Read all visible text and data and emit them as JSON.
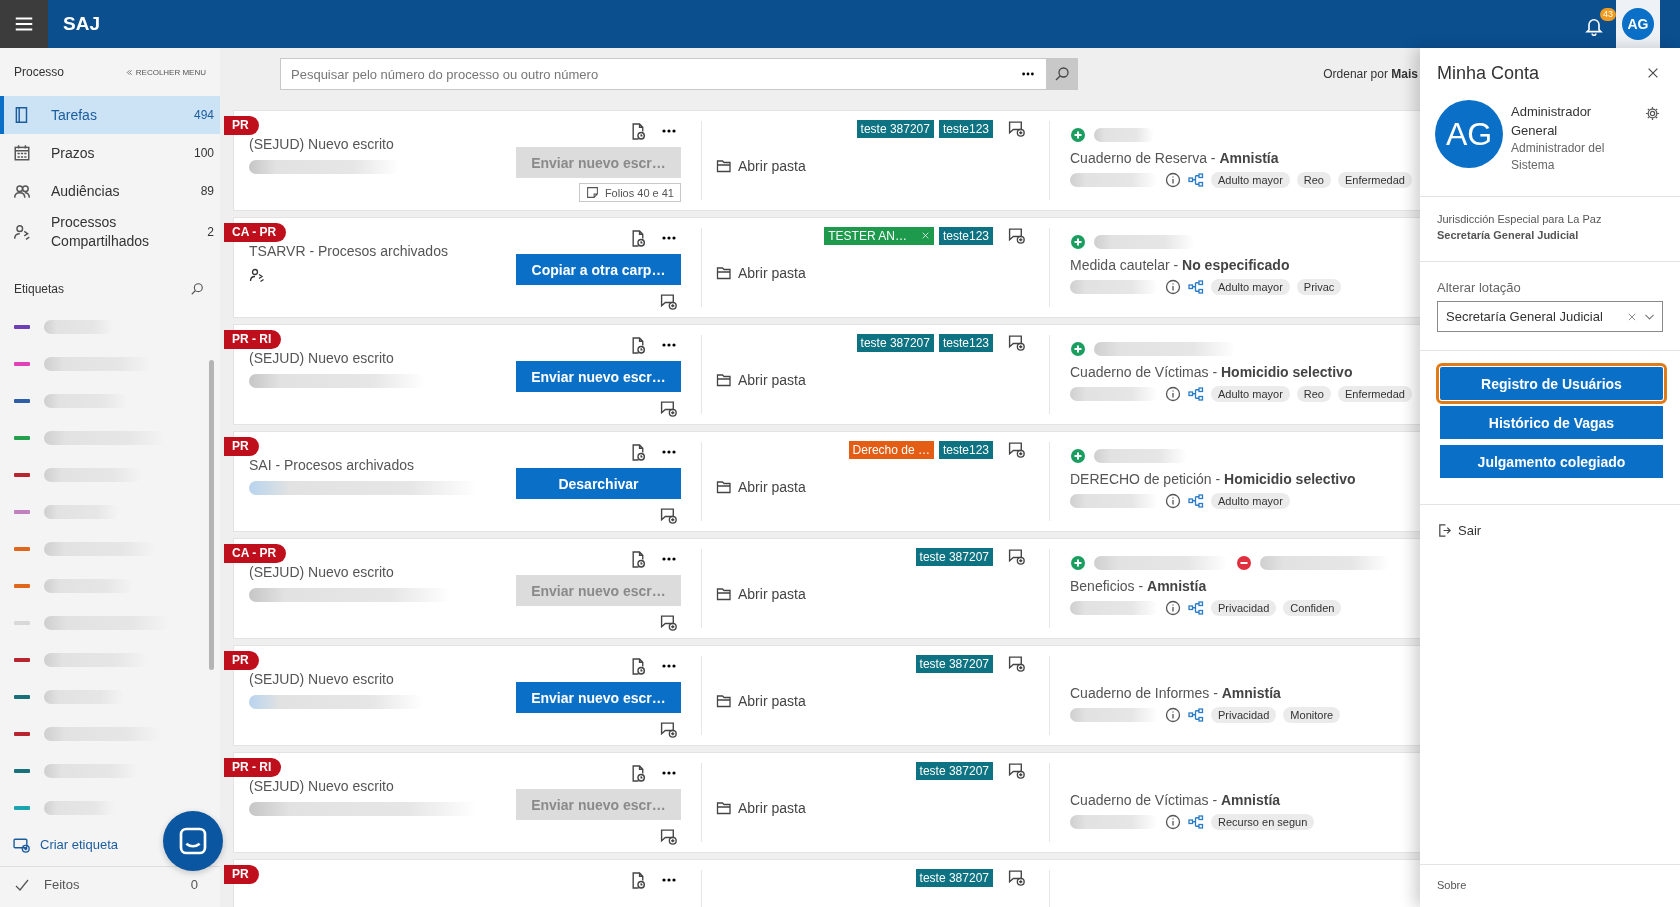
{
  "header": {
    "app_name": "SAJ",
    "notifications": "43",
    "avatar": "AG"
  },
  "sidebar": {
    "section_title": "Processo",
    "collapse": "RECOLHER MENU",
    "items": [
      {
        "label": "Tarefas",
        "count": "494",
        "selected": true
      },
      {
        "label": "Prazos",
        "count": "100",
        "selected": false
      },
      {
        "label": "Audiências",
        "count": "89",
        "selected": false
      },
      {
        "label": "Processos Compartilhados",
        "count": "2",
        "selected": false
      }
    ],
    "labels_title": "Etiquetas",
    "labels": [
      {
        "color": "#6b3fb5"
      },
      {
        "color": "#e040b8"
      },
      {
        "color": "#2f5ea8"
      },
      {
        "color": "#22a04b"
      },
      {
        "color": "#b8252e"
      },
      {
        "color": "#c07fc0"
      },
      {
        "color": "#e0661a"
      },
      {
        "color": "#e0661a"
      },
      {
        "color": "#d8d8d8"
      },
      {
        "color": "#b8252e"
      },
      {
        "color": "#17707a"
      },
      {
        "color": "#b8252e"
      },
      {
        "color": "#17707a"
      },
      {
        "color": "#1aa3b0"
      }
    ],
    "create_label": "Criar etiqueta",
    "done": {
      "label": "Feitos",
      "count": "0"
    }
  },
  "search": {
    "placeholder": "Pesquisar pelo número do processo ou outro número",
    "sort": "Ordenar por **Mais**"
  },
  "cards": [
    {
      "badge": "PR",
      "title": "(SEJUD) Nuevo escrito",
      "shared": false,
      "action": {
        "label": "Enviar nuevo escr…",
        "disabled": true
      },
      "note": "Folios 40 e 41",
      "folder": "Abrir pasta",
      "tags": [
        {
          "label": "teste 387207",
          "color": "#0d7383",
          "removable": false
        },
        {
          "label": "teste123",
          "color": "#0d7383",
          "removable": false
        }
      ],
      "added": true,
      "removed": false,
      "case_title": "Cuaderno de Reserva - **Amnistía**",
      "chips": [
        "Adulto mayor",
        "Reo",
        "Enfermedad"
      ]
    },
    {
      "badge": "CA - PR",
      "title": "TSARVR - Procesos archivados",
      "shared": true,
      "action": {
        "label": "Copiar a otra carp…",
        "disabled": false
      },
      "folder": "Abrir pasta",
      "tags": [
        {
          "label": "TESTER AN…",
          "color": "#1e9a4c",
          "removable": true
        },
        {
          "label": "teste123",
          "color": "#0d7383",
          "removable": false
        }
      ],
      "added": true,
      "removed": false,
      "case_title": "Medida cautelar - **No especificado**",
      "chips": [
        "Adulto mayor",
        "Privac"
      ]
    },
    {
      "badge": "PR - RI",
      "title": "(SEJUD) Nuevo escrito",
      "shared": false,
      "action": {
        "label": "Enviar nuevo escr…",
        "disabled": false
      },
      "folder": "Abrir pasta",
      "tags": [
        {
          "label": "teste 387207",
          "color": "#0d7383",
          "removable": false
        },
        {
          "label": "teste123",
          "color": "#0d7383",
          "removable": false
        }
      ],
      "added": true,
      "removed": false,
      "case_title": "Cuaderno de Víctimas - **Homicidio selectivo**",
      "chips": [
        "Adulto mayor",
        "Reo",
        "Enfermedad"
      ]
    },
    {
      "badge": "PR",
      "title": "SAI - Procesos archivados",
      "shared": false,
      "action": {
        "label": "Desarchivar",
        "disabled": false
      },
      "folder": "Abrir pasta",
      "tags": [
        {
          "label": "Derecho de …",
          "color": "#e35d14",
          "removable": false
        },
        {
          "label": "teste123",
          "color": "#0d7383",
          "removable": false
        }
      ],
      "added": true,
      "removed": false,
      "case_title": "DERECHO de petición - **Homicidio selectivo**",
      "chips": [
        "Adulto mayor"
      ]
    },
    {
      "badge": "CA - PR",
      "title": "(SEJUD) Nuevo escrito",
      "shared": false,
      "action": {
        "label": "Enviar nuevo escr…",
        "disabled": true
      },
      "folder": "Abrir pasta",
      "tags": [
        {
          "label": "teste 387207",
          "color": "#0d7383",
          "removable": false
        }
      ],
      "added": true,
      "removed": true,
      "case_title": "Beneficios - **Amnistía**",
      "chips": [
        "Privacidad",
        "Confiden"
      ]
    },
    {
      "badge": "PR",
      "title": "(SEJUD) Nuevo escrito",
      "shared": false,
      "action": {
        "label": "Enviar nuevo escr…",
        "disabled": false
      },
      "folder": "Abrir pasta",
      "tags": [
        {
          "label": "teste 387207",
          "color": "#0d7383",
          "removable": false
        }
      ],
      "added": false,
      "removed": false,
      "case_title": "Cuaderno de Informes - **Amnistía**",
      "chips": [
        "Privacidad",
        "Monitore"
      ]
    },
    {
      "badge": "PR - RI",
      "title": "(SEJUD) Nuevo escrito",
      "shared": false,
      "action": {
        "label": "Enviar nuevo escr…",
        "disabled": true
      },
      "folder": "Abrir pasta",
      "tags": [
        {
          "label": "teste 387207",
          "color": "#0d7383",
          "removable": false
        }
      ],
      "added": false,
      "removed": false,
      "case_title": "Cuaderno de Víctimas - **Amnistía**",
      "chips": [
        "Recurso en segun"
      ]
    },
    {
      "badge": "PR",
      "tags": [
        {
          "label": "teste 387207",
          "color": "#0d7383",
          "removable": false
        }
      ]
    }
  ],
  "panel": {
    "title": "Minha Conta",
    "avatar": "AG",
    "name": "Administrador General",
    "role": "Administrador del Sistema",
    "org": "Jurisdicción Especial para La Paz",
    "unit": "Secretaría General Judicial",
    "field_label": "Alterar lotação",
    "field_value": "Secretaría General Judicial",
    "buttons": [
      {
        "label": "Registro de Usuários",
        "focused": true
      },
      {
        "label": "Histórico de Vagas",
        "focused": false
      },
      {
        "label": "Julgamento colegiado",
        "focused": false
      }
    ],
    "logout": "Sair",
    "footer": "Sobre"
  }
}
